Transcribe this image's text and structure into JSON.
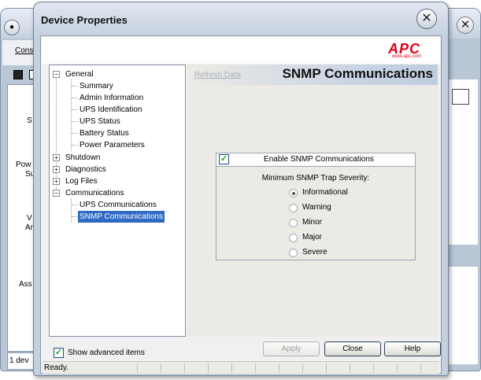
{
  "background_window": {
    "menu_text": "Cons",
    "left_labels": [
      "S",
      "Pow",
      "Su",
      "V",
      "Ar",
      "Ass"
    ],
    "status_text": "1 dev"
  },
  "dialog": {
    "title": "Device Properties",
    "close_glyph": "✕",
    "logo": {
      "word": "APC",
      "url": "www.apc.com",
      "color": "#e2001a"
    }
  },
  "tree": {
    "items": [
      {
        "label": "General",
        "level": 0,
        "toggle": "−"
      },
      {
        "label": "Summary",
        "level": 1
      },
      {
        "label": "Admin Information",
        "level": 1
      },
      {
        "label": "UPS Identification",
        "level": 1
      },
      {
        "label": "UPS Status",
        "level": 1
      },
      {
        "label": "Battery Status",
        "level": 1
      },
      {
        "label": "Power Parameters",
        "level": 1
      },
      {
        "label": "Shutdown",
        "level": 0,
        "toggle": "+"
      },
      {
        "label": "Diagnostics",
        "level": 0,
        "toggle": "+"
      },
      {
        "label": "Log Files",
        "level": 0,
        "toggle": "+"
      },
      {
        "label": "Communications",
        "level": 0,
        "toggle": "−"
      },
      {
        "label": "UPS Communications",
        "level": 1
      },
      {
        "label": "SNMP Communications",
        "level": 1,
        "selected": true
      }
    ]
  },
  "panel": {
    "refresh_label": "Refresh Data",
    "title": "SNMP Communications",
    "enable_label": "Enable SNMP Communications",
    "enable_checked": true,
    "severity_label": "Minimum SNMP Trap Severity:",
    "severities": [
      "Informational",
      "Warning",
      "Minor",
      "Major",
      "Severe"
    ],
    "selected_severity": "Informational"
  },
  "footer": {
    "show_advanced_label": "Show advanced items",
    "show_advanced_checked": true,
    "apply_label": "Apply",
    "close_label": "Close",
    "help_label": "Help",
    "status_text": "Ready."
  }
}
